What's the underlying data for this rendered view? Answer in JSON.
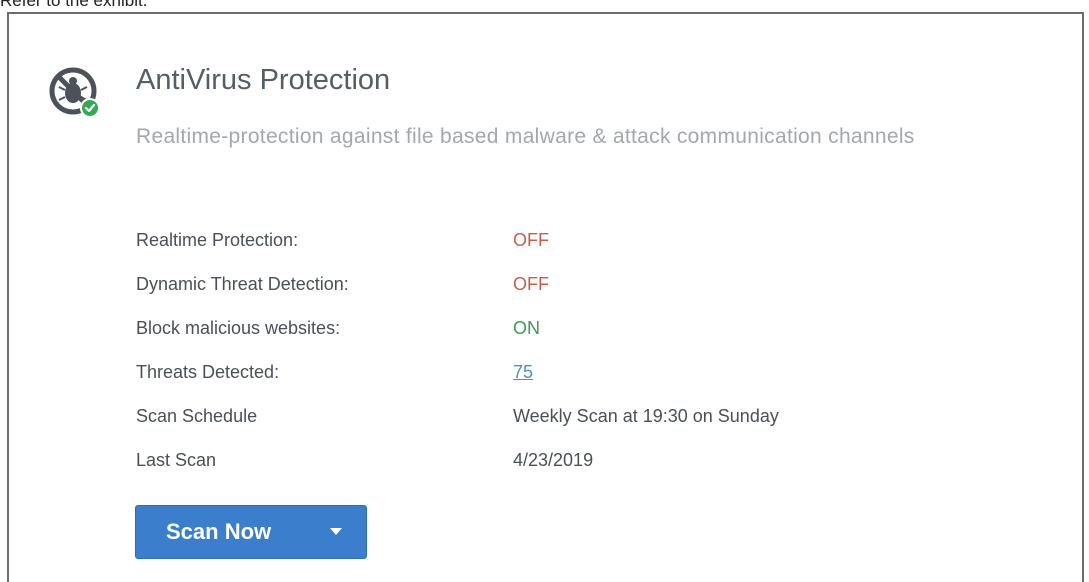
{
  "caption": "Refer to the exhibit.",
  "card": {
    "title": "AntiVirus Protection",
    "subtitle": "Realtime-protection against file based malware & attack communication channels",
    "icon": "bug-shield-check-icon"
  },
  "status_rows": [
    {
      "label": "Realtime Protection:",
      "value": "OFF",
      "state": "off"
    },
    {
      "label": "Dynamic Threat Detection:",
      "value": "OFF",
      "state": "off"
    },
    {
      "label": "Block malicious websites:",
      "value": "ON",
      "state": "on"
    },
    {
      "label": "Threats Detected:",
      "value": "75",
      "state": "link"
    },
    {
      "label": "Scan Schedule",
      "value": "Weekly Scan at 19:30 on Sunday",
      "state": "plain"
    },
    {
      "label": "Last Scan",
      "value": "4/23/2019",
      "state": "plain"
    }
  ],
  "actions": {
    "scan_now_label": "Scan Now"
  },
  "colors": {
    "off": "#c4604a",
    "on": "#3f9a52",
    "link": "#4a90c9",
    "button": "#3b7fcc",
    "check": "#34a853"
  }
}
